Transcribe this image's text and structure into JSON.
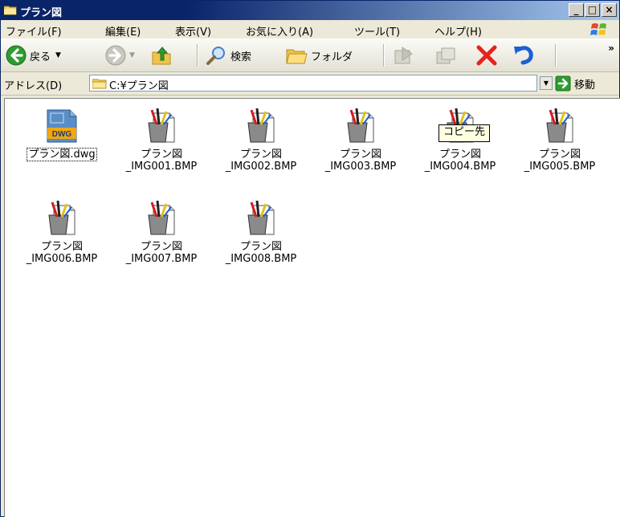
{
  "window": {
    "title": "プラン図"
  },
  "caption_buttons": {
    "minimize": "_",
    "maximize": "□",
    "close": "×"
  },
  "menu": [
    "ファイル(F)",
    "編集(E)",
    "表示(V)",
    "お気に入り(A)",
    "ツール(T)",
    "ヘルプ(H)"
  ],
  "toolbar": {
    "back": "戻る",
    "search": "検索",
    "folders": "フォルダ",
    "more": "»"
  },
  "address": {
    "label": "アドレス(D)",
    "value": "C:¥プラン図",
    "go": "移動"
  },
  "tooltip": "コピー先",
  "files": [
    {
      "name": "プラン図.dwg",
      "icon": "dwg-file-icon",
      "badge": "DWG"
    },
    {
      "name_line1": "プラン図",
      "name_line2": "_IMG001.BMP",
      "icon": "paint-bmp-icon"
    },
    {
      "name_line1": "プラン図",
      "name_line2": "_IMG002.BMP",
      "icon": "paint-bmp-icon"
    },
    {
      "name_line1": "プラン図",
      "name_line2": "_IMG003.BMP",
      "icon": "paint-bmp-icon"
    },
    {
      "name_line1": "プラン図",
      "name_line2": "_IMG004.BMP",
      "icon": "paint-bmp-icon"
    },
    {
      "name_line1": "プラン図",
      "name_line2": "_IMG005.BMP",
      "icon": "paint-bmp-icon"
    },
    {
      "name_line1": "プラン図",
      "name_line2": "_IMG006.BMP",
      "icon": "paint-bmp-icon"
    },
    {
      "name_line1": "プラン図",
      "name_line2": "_IMG007.BMP",
      "icon": "paint-bmp-icon"
    },
    {
      "name_line1": "プラン図",
      "name_line2": "_IMG008.BMP",
      "icon": "paint-bmp-icon"
    }
  ],
  "colors": {
    "titlebar": "#0a246a",
    "back_arrow": "#2e9c30",
    "delete_x": "#e8221b",
    "undo": "#1c5fd6"
  }
}
